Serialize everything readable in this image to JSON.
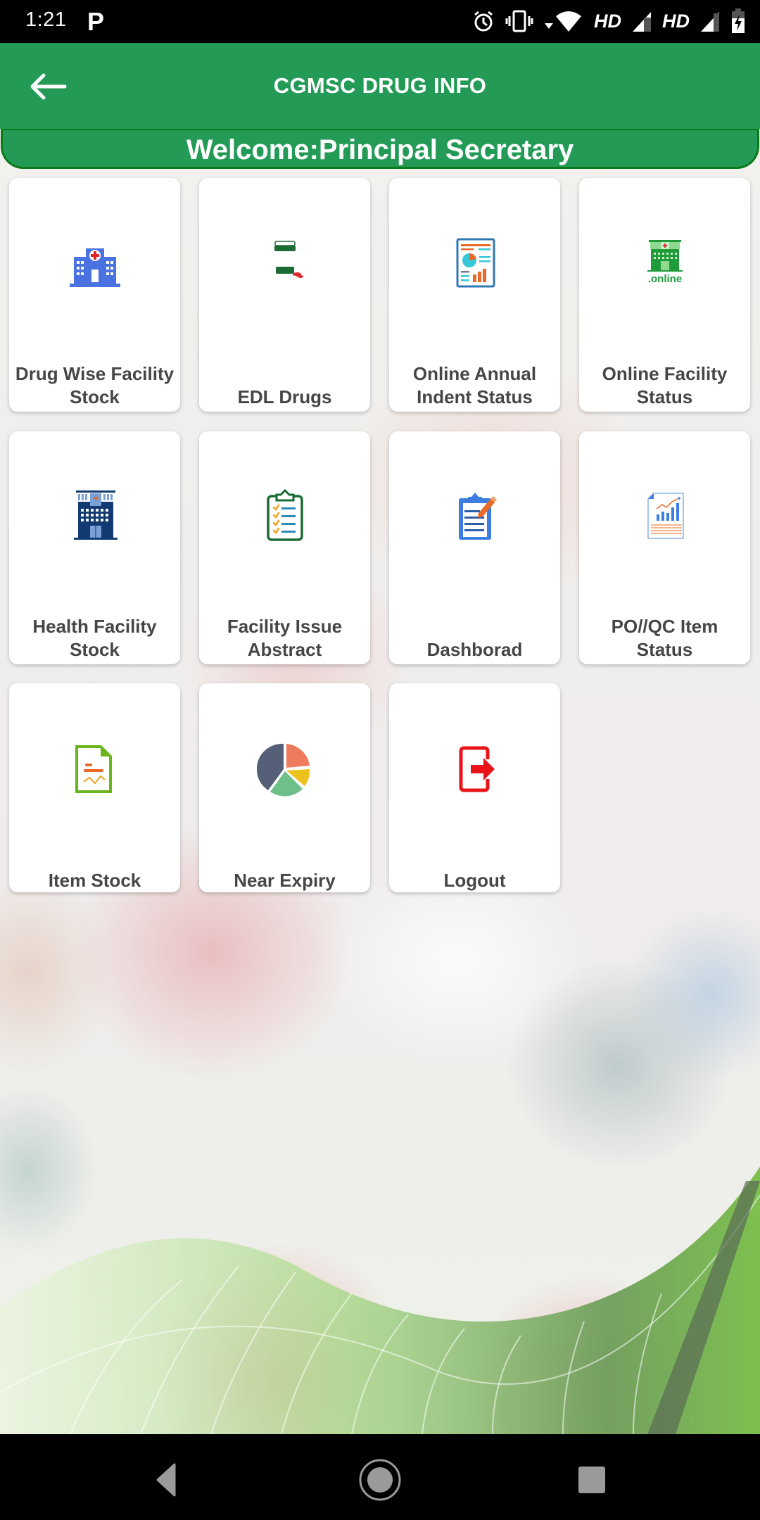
{
  "status_bar": {
    "time": "1:21",
    "notification_icon": "parking-p-icon",
    "icons": [
      "alarm-icon",
      "vibrate-icon",
      "wifi-icon",
      "signal-icon",
      "signal-icon",
      "battery-charging-icon"
    ],
    "network_label_1": "HD",
    "network_label_2": "HD"
  },
  "app_bar": {
    "title": "CGMSC DRUG INFO",
    "back_icon": "arrow-left-icon"
  },
  "welcome": {
    "text": "Welcome:Principal Secretary"
  },
  "colors": {
    "primary_green": "#239b56",
    "band_border": "#0b7a1a",
    "card_label": "#464646"
  },
  "menu": {
    "items": [
      {
        "label": "Drug Wise Facility Stock",
        "icon": "hospital-icon"
      },
      {
        "label": "EDL Drugs",
        "icon": "medicine-bottle-icon"
      },
      {
        "label": "Online Annual Indent Status",
        "icon": "report-chart-icon"
      },
      {
        "label": "Online Facility Status",
        "icon": "online-hospital-icon"
      },
      {
        "label": "Health Facility Stock",
        "icon": "health-building-icon"
      },
      {
        "label": "Facility Issue Abstract",
        "icon": "checklist-clipboard-icon"
      },
      {
        "label": "Dashborad",
        "icon": "clipboard-edit-icon"
      },
      {
        "label": "PO//QC Item Status",
        "icon": "document-bar-chart-icon"
      },
      {
        "label": "Item Stock",
        "icon": "document-graph-icon"
      },
      {
        "label": "Near Expiry",
        "icon": "pie-chart-icon"
      },
      {
        "label": "Logout",
        "icon": "logout-icon"
      }
    ]
  },
  "online_badge_text": ".online",
  "nav_bar": {
    "back": "nav-back-icon",
    "home": "nav-home-icon",
    "recents": "nav-recents-icon"
  }
}
